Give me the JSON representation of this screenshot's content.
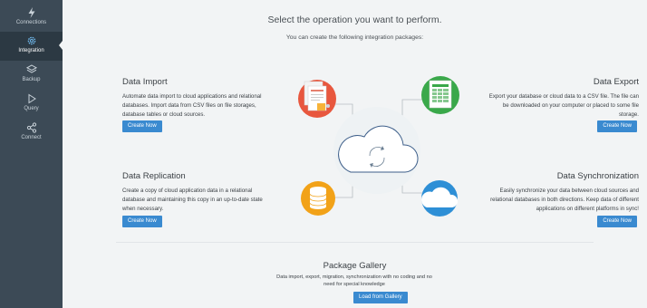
{
  "sidebar": {
    "items": [
      {
        "label": "Connections",
        "icon": "lightning-icon",
        "active": false
      },
      {
        "label": "Integration",
        "icon": "gear-icon",
        "active": true
      },
      {
        "label": "Backup",
        "icon": "layers-icon",
        "active": false
      },
      {
        "label": "Query",
        "icon": "play-icon",
        "active": false
      },
      {
        "label": "Connect",
        "icon": "share-icon",
        "active": false
      }
    ]
  },
  "main": {
    "title": "Select the operation you want to perform.",
    "subtitle": "You can create the following integration packages:",
    "operations": {
      "data_import": {
        "title": "Data Import",
        "description": "Automate data import to cloud applications and relational databases. Import data from CSV files on file storages, database tables or cloud sources.",
        "button": "Create Now"
      },
      "data_export": {
        "title": "Data Export",
        "description": "Export your database or cloud data to a CSV file. The file can be downloaded on your computer or placed to some file storage.",
        "button": "Create Now"
      },
      "data_replication": {
        "title": "Data Replication",
        "description": "Create a copy of cloud application data in a relational database and maintaining this copy in an up-to-date state when necessary.",
        "button": "Create Now"
      },
      "data_synchronization": {
        "title": "Data Synchronization",
        "description": "Easily synchronize your data between cloud sources and relational databases in both directions. Keep data of different applications on different platforms in sync!",
        "button": "Create Now"
      }
    },
    "gallery": {
      "title": "Package Gallery",
      "description": "Data import, export, migration, synchronization with no coding and no need for special knowledge",
      "button": "Load from Gallery"
    }
  },
  "colors": {
    "sidebar_bg": "#3c4a56",
    "sidebar_active": "#2c3943",
    "accent_button": "#3a8ad0",
    "import_circle": "#e8573e",
    "export_circle": "#3aa84a",
    "replication_circle": "#f2a218",
    "sync_circle": "#2e8fd6"
  }
}
